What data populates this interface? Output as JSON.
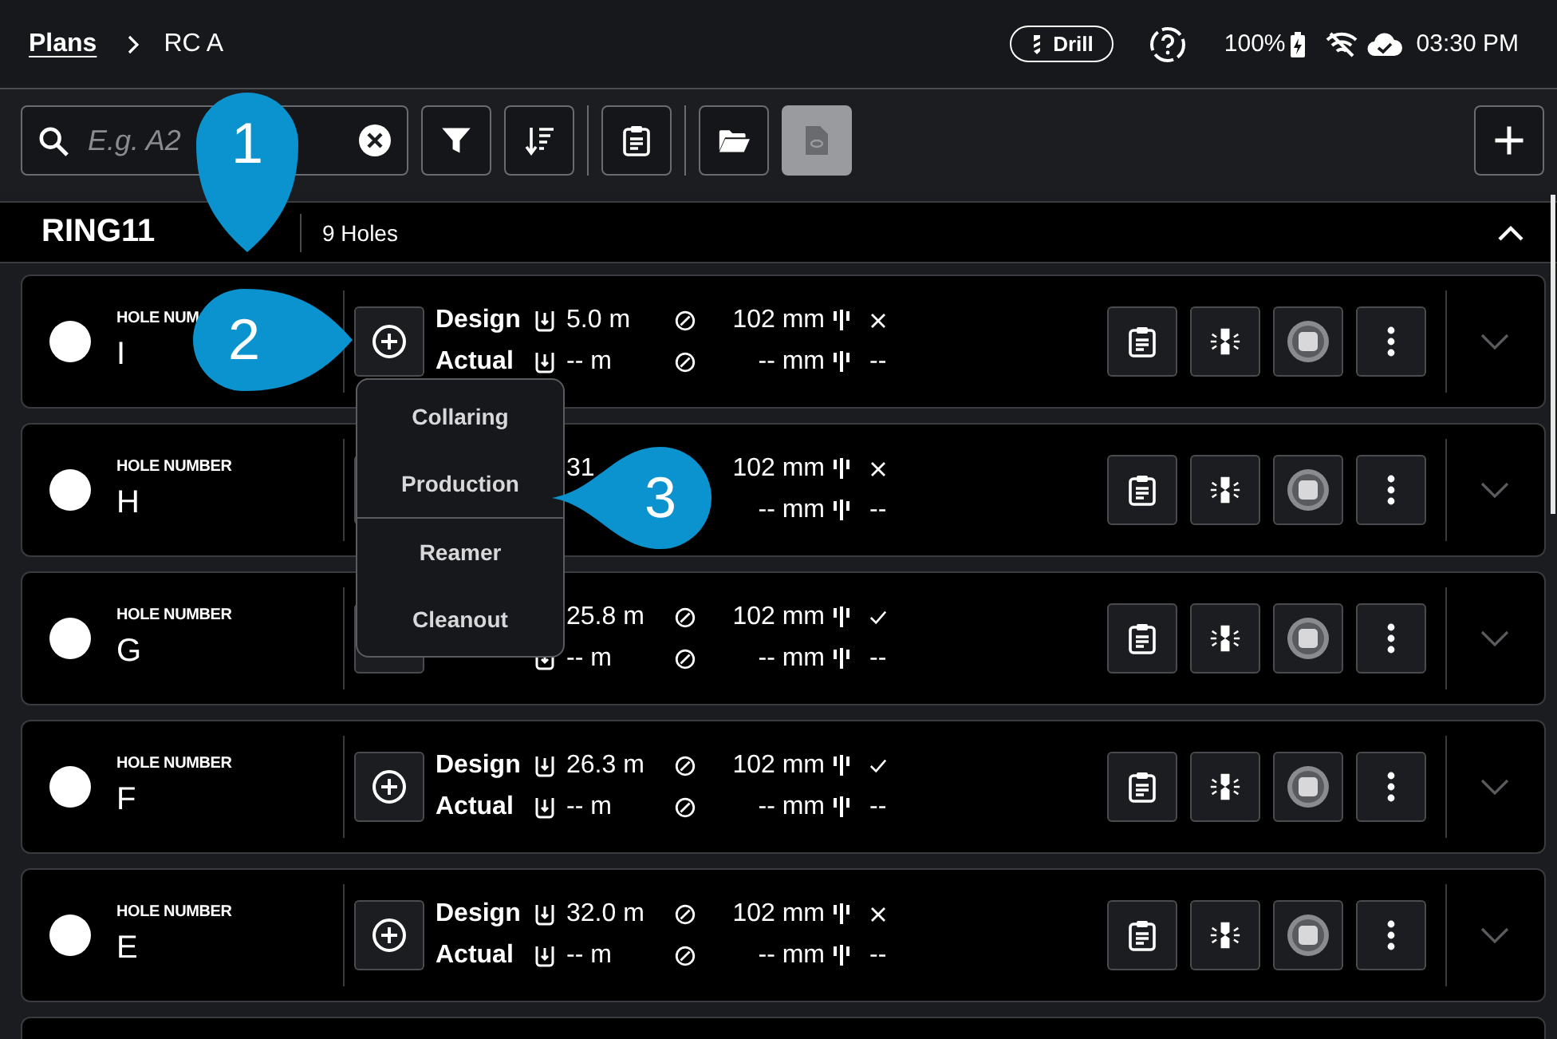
{
  "top_bar": {
    "breadcrumb": [
      {
        "label": "Plans",
        "link": true
      },
      {
        "label": "RC A",
        "link": false
      }
    ],
    "mode_badge": "Drill",
    "battery": "100%",
    "time": "03:30 PM"
  },
  "toolbar": {
    "search": {
      "placeholder": "E.g. A2"
    },
    "buttons": [
      {
        "kind": "filter",
        "disabled": false
      },
      {
        "kind": "sort",
        "disabled": false
      },
      {
        "kind": "report",
        "disabled": false
      },
      {
        "kind": "folder",
        "disabled": false
      },
      {
        "kind": "document",
        "disabled": true
      }
    ]
  },
  "ring": {
    "name": "RING11",
    "count": "9 Holes",
    "expanded": true
  },
  "holes": [
    {
      "label": "HOLE NUM",
      "number": "I",
      "selected": false,
      "design_label": "Design",
      "actual_label": "Actual",
      "design_depth": "5.0 m",
      "actual_depth": "-- m",
      "design_diameter": "102 mm",
      "actual_diameter": "-- mm",
      "bit_ok": false,
      "actual_bit": "--",
      "expanded": false
    },
    {
      "label": "HOLE NUMBER",
      "number": "H",
      "selected": false,
      "design_depth": "31",
      "design_diameter": "102 mm",
      "actual_diameter": "-- mm",
      "bit_ok": false,
      "actual_bit": "--",
      "expanded": false
    },
    {
      "label": "HOLE NUMBER",
      "number": "G",
      "selected": false,
      "design_depth": "25.8 m",
      "actual_depth": "-- m",
      "design_diameter": "102 mm",
      "actual_diameter": "-- mm",
      "bit_ok": true,
      "actual_bit": "--",
      "expanded": false
    },
    {
      "label": "HOLE NUMBER",
      "number": "F",
      "selected": false,
      "design_label": "Design",
      "actual_label": "Actual",
      "design_depth": "26.3 m",
      "actual_depth": "-- m",
      "design_diameter": "102 mm",
      "actual_diameter": "-- mm",
      "bit_ok": true,
      "actual_bit": "--",
      "expanded": false
    },
    {
      "label": "HOLE NUMBER",
      "number": "E",
      "selected": false,
      "design_label": "Design",
      "actual_label": "Actual",
      "design_depth": "32.0 m",
      "actual_depth": "-- m",
      "design_diameter": "102 mm",
      "actual_diameter": "-- mm",
      "bit_ok": false,
      "actual_bit": "--",
      "expanded": false
    }
  ],
  "menu": {
    "items": [
      {
        "label": "Collaring",
        "divider_before": false
      },
      {
        "label": "Production",
        "divider_before": false
      },
      {
        "label": "Reamer",
        "divider_before": true
      },
      {
        "label": "Cleanout",
        "divider_before": false
      }
    ]
  },
  "callouts": [
    {
      "number": "1",
      "kind": "down"
    },
    {
      "number": "2",
      "kind": "right"
    },
    {
      "number": "3",
      "kind": "left"
    }
  ]
}
